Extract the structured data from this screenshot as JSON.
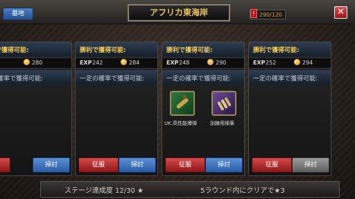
{
  "header": {
    "base_button": "基地",
    "title": "アフリカ東海岸",
    "stamina_icon": "!",
    "stamina": "290/120",
    "close": "✕"
  },
  "cards": [
    {
      "win_label": "勝利で獲得可能:",
      "exp_label": "EXP",
      "exp": "",
      "gold": "280",
      "chance_label": "一定の確率で獲得可能:",
      "conquer": "征服",
      "sweep": "掃討",
      "items": []
    },
    {
      "win_label": "勝利で獲得可能:",
      "exp_label": "EXP",
      "exp": "242",
      "gold": "284",
      "chance_label": "一定の確率で獲得可能:",
      "conquer": "征服",
      "sweep": "掃討",
      "items": []
    },
    {
      "win_label": "勝利で獲得可能:",
      "exp_label": "EXP",
      "exp": "248",
      "gold": "290",
      "chance_label": "一定の確率で獲得可能:",
      "conquer": "征服",
      "sweep": "掃討",
      "items": [
        {
          "name": "UK.高性能爆弾",
          "icon": "bomb-icon"
        },
        {
          "name": "訓練用弾薬",
          "icon": "ammo-icon"
        }
      ]
    },
    {
      "win_label": "勝利で獲得可能:",
      "exp_label": "EXP",
      "exp": "252",
      "gold": "294",
      "chance_label": "一定の確率で獲得可能:",
      "conquer": "征服",
      "sweep": "掃討",
      "items": []
    }
  ],
  "footer": {
    "progress": "ステージ達成度 12/30 ★",
    "clear_goal": "5ラウンド内にクリアで★3"
  },
  "colors": {
    "title_gold": "#e7c45f",
    "conquer_red": "#d64848",
    "sweep_blue": "#5a8fd4"
  }
}
